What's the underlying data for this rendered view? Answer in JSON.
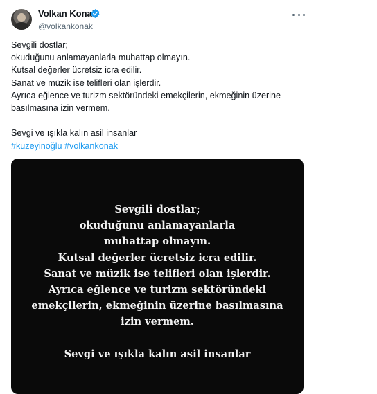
{
  "author": {
    "display_name": "Volkan Konak",
    "handle": "@volkankonak",
    "verified": true
  },
  "icons": {
    "verified": "verified-badge-icon",
    "more": "more-options-icon"
  },
  "colors": {
    "accent": "#1d9bf0",
    "text": "#0f1419",
    "muted": "#536471",
    "media_background": "#0a0a0a"
  },
  "tweet": {
    "lines": [
      "Sevgili dostlar;",
      "okuduğunu anlamayanlarla muhattap olmayın.",
      "Kutsal değerler ücretsiz icra edilir.",
      "Sanat ve müzik ise telifleri olan işlerdir.",
      "Ayrıca eğlence ve turizm sektöründeki emekçilerin, ekmeğinin üzerine",
      "basılmasına izin vermem.",
      "Sevgi ve ışıkla kalın asil insanlar"
    ],
    "hashtags": [
      "#kuzeyinoğlu",
      "#volkankonak"
    ]
  },
  "media": {
    "lines": [
      "Sevgili dostlar;",
      "okuduğunu anlamayanlarla",
      "muhattap olmayın.",
      "Kutsal değerler ücretsiz icra edilir.",
      "Sanat ve müzik ise telifleri olan işlerdir.",
      "Ayrıca eğlence ve turizm sektöründeki",
      "emekçilerin, ekmeğinin üzerine basılmasına",
      "izin vermem.",
      "Sevgi ve ışıkla kalın asil insanlar"
    ]
  }
}
